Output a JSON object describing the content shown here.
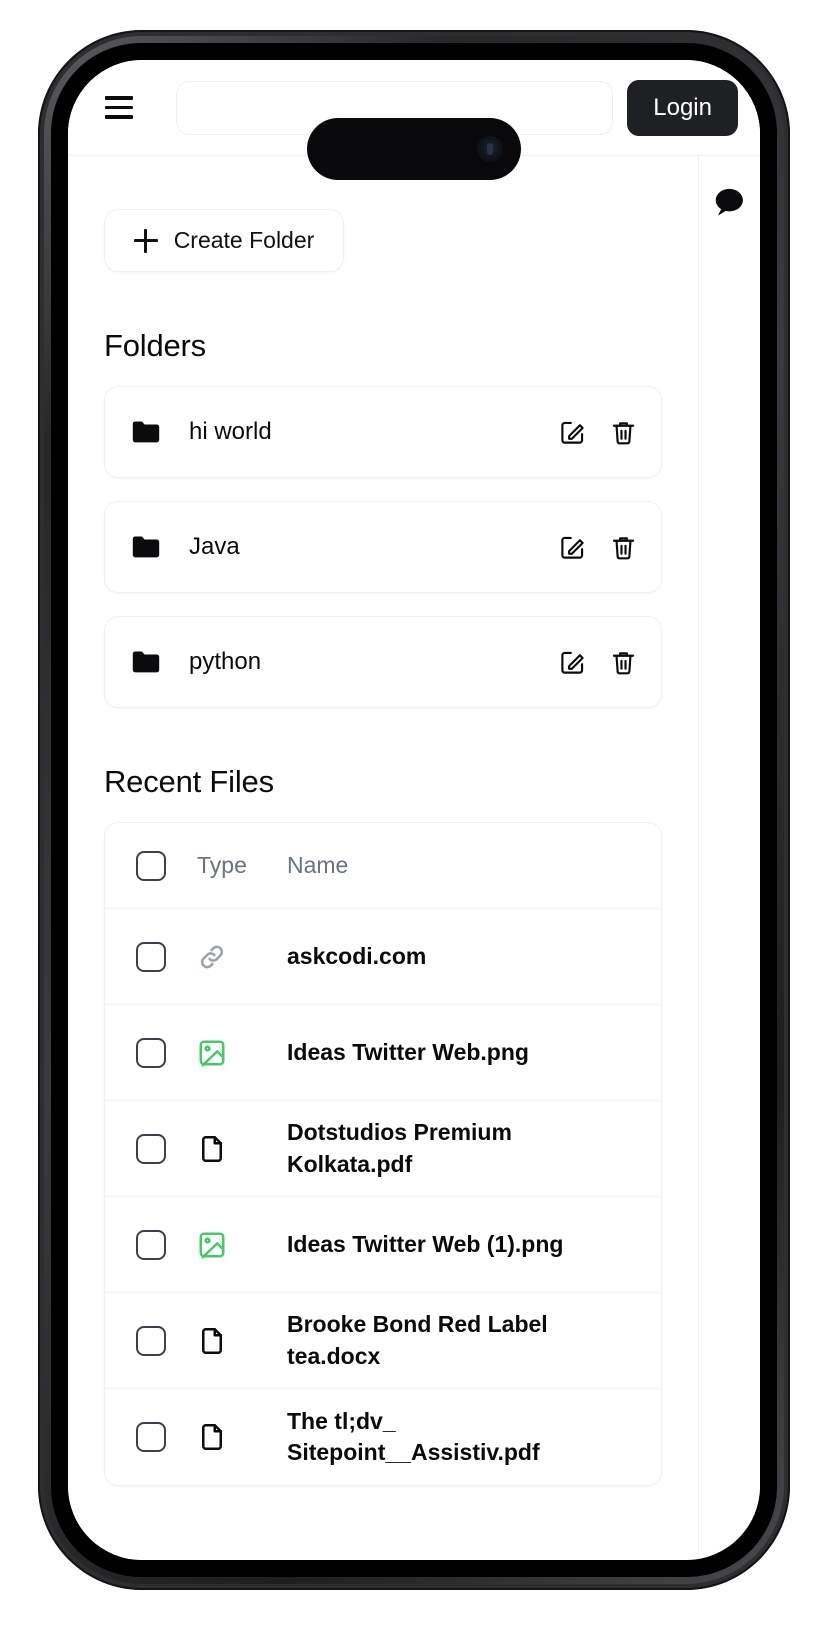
{
  "header": {
    "menu_icon": "hamburger-menu-icon",
    "login_label": "Login",
    "address_bar_value": ""
  },
  "right_rail": {
    "chat_icon": "chat-bubble-icon"
  },
  "toolbar": {
    "create_folder_label": "Create Folder",
    "create_folder_icon": "plus-icon"
  },
  "folders_section": {
    "title": "Folders",
    "items": [
      {
        "name": "hi world",
        "icon": "folder-icon",
        "edit_icon": "edit-square-icon",
        "delete_icon": "trash-icon"
      },
      {
        "name": "Java",
        "icon": "folder-icon",
        "edit_icon": "edit-square-icon",
        "delete_icon": "trash-icon"
      },
      {
        "name": "python",
        "icon": "folder-icon",
        "edit_icon": "edit-square-icon",
        "delete_icon": "trash-icon"
      }
    ]
  },
  "recent_files_section": {
    "title": "Recent Files",
    "columns": {
      "type": "Type",
      "name": "Name"
    },
    "rows": [
      {
        "name": "askcodi.com",
        "icon": "link-icon",
        "icon_color": "#9aa1ad"
      },
      {
        "name": "Ideas Twitter Web.png",
        "icon": "image-icon",
        "icon_color": "#4ac767"
      },
      {
        "name": "Dotstudios Premium Kolkata.pdf",
        "icon": "document-icon",
        "icon_color": "#0b0b0d"
      },
      {
        "name": "Ideas Twitter Web (1).png",
        "icon": "image-icon",
        "icon_color": "#4ac767"
      },
      {
        "name": "Brooke Bond Red Label tea.docx",
        "icon": "document-icon",
        "icon_color": "#0b0b0d"
      },
      {
        "name": "The tl;dv_ Sitepoint__Assistiv.pdf",
        "icon": "document-icon",
        "icon_color": "#0b0b0d"
      }
    ]
  },
  "colors": {
    "accent_dark": "#1f2024",
    "green": "#4ac767",
    "border": "#eef0f4",
    "muted_text": "#6b7280"
  }
}
